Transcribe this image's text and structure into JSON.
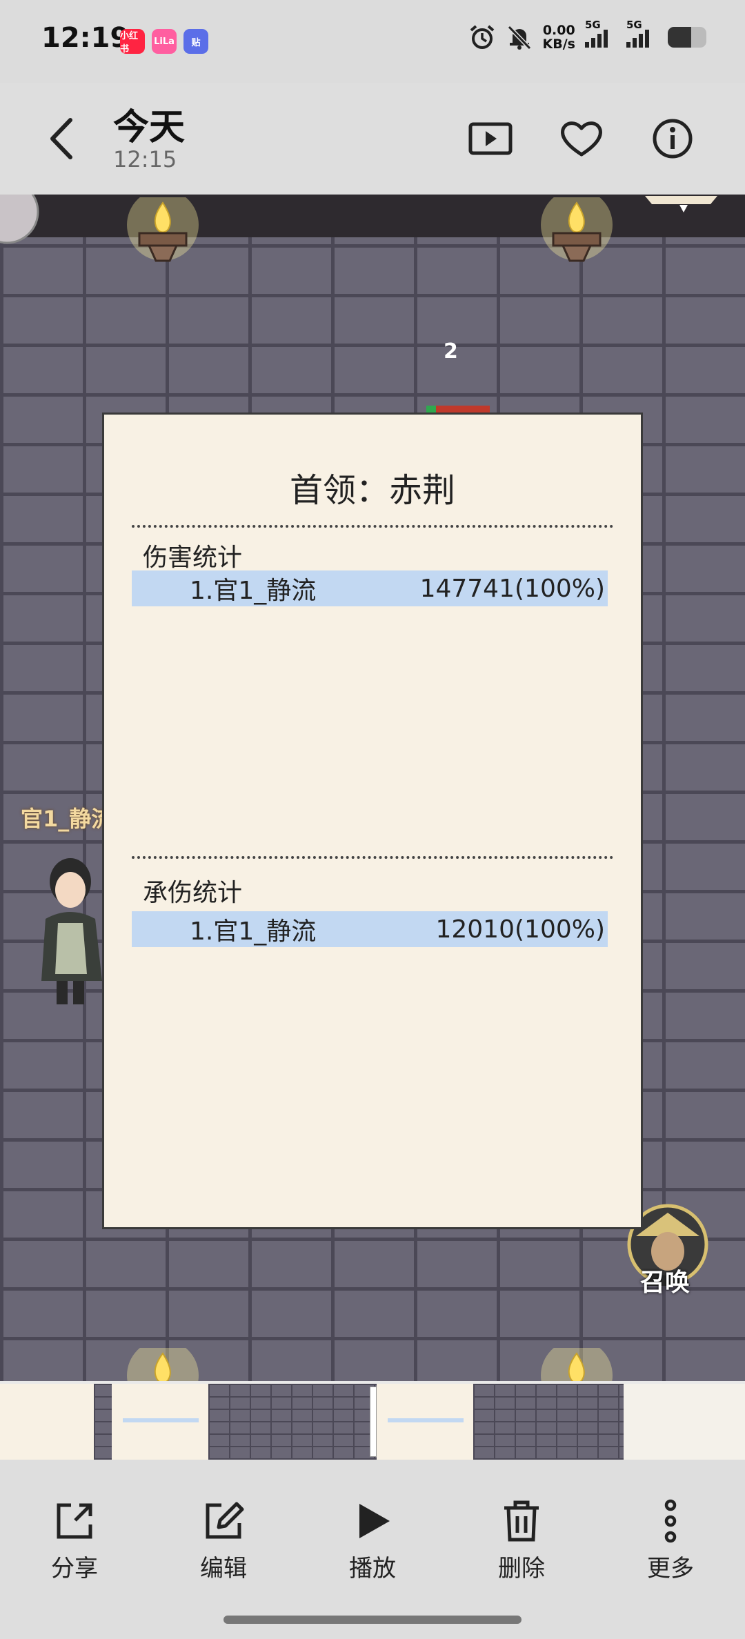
{
  "status_bar": {
    "time": "12:19",
    "app_badges": [
      {
        "text": "小红书",
        "color": "#ff2442"
      },
      {
        "text": "LiLa",
        "color": "#ff5ea0"
      },
      {
        "text": "贴",
        "color": "#5b6ee8"
      }
    ],
    "net_speed_value": "0.00",
    "net_speed_unit": "KB/s",
    "sim1_label": "5G",
    "sim2_label": "5G",
    "battery_level": 0.6,
    "icons": [
      "alarm-icon",
      "mute-bell-icon",
      "signal-icon",
      "battery-icon"
    ]
  },
  "header": {
    "title": "今天",
    "subtitle": "12:15",
    "icons": [
      "back-icon",
      "play-video-icon",
      "heart-icon",
      "info-icon"
    ]
  },
  "game": {
    "wave_number": "2",
    "hero_name": "官1_静流",
    "summon_label": "召唤",
    "panel": {
      "title": "首领：赤荆",
      "damage_section": {
        "label": "伤害统计",
        "rows": [
          {
            "name": "1.官1_静流",
            "value": "147741(100%)"
          }
        ]
      },
      "taken_section": {
        "label": "承伤统计",
        "rows": [
          {
            "name": "1.官1_静流",
            "value": "12010(100%)"
          }
        ]
      }
    }
  },
  "bottom_actions": [
    {
      "label": "分享",
      "icon": "share-icon"
    },
    {
      "label": "编辑",
      "icon": "edit-icon"
    },
    {
      "label": "播放",
      "icon": "play-icon"
    },
    {
      "label": "删除",
      "icon": "delete-icon"
    },
    {
      "label": "更多",
      "icon": "more-icon"
    }
  ]
}
